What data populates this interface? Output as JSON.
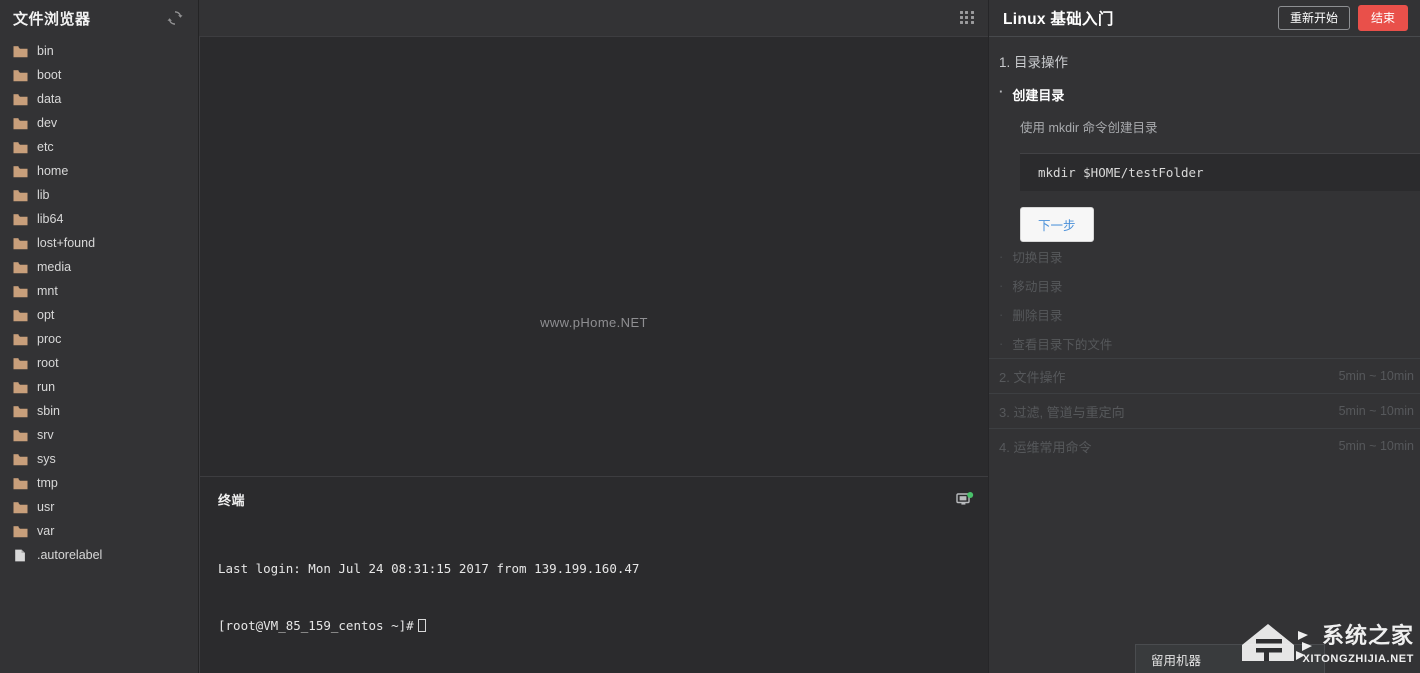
{
  "sidebar": {
    "title": "文件浏览器",
    "refresh_icon": "refresh-icon",
    "items": [
      {
        "label": "bin",
        "type": "folder"
      },
      {
        "label": "boot",
        "type": "folder"
      },
      {
        "label": "data",
        "type": "folder"
      },
      {
        "label": "dev",
        "type": "folder"
      },
      {
        "label": "etc",
        "type": "folder"
      },
      {
        "label": "home",
        "type": "folder"
      },
      {
        "label": "lib",
        "type": "folder"
      },
      {
        "label": "lib64",
        "type": "folder"
      },
      {
        "label": "lost+found",
        "type": "folder"
      },
      {
        "label": "media",
        "type": "folder"
      },
      {
        "label": "mnt",
        "type": "folder"
      },
      {
        "label": "opt",
        "type": "folder"
      },
      {
        "label": "proc",
        "type": "folder"
      },
      {
        "label": "root",
        "type": "folder"
      },
      {
        "label": "run",
        "type": "folder"
      },
      {
        "label": "sbin",
        "type": "folder"
      },
      {
        "label": "srv",
        "type": "folder"
      },
      {
        "label": "sys",
        "type": "folder"
      },
      {
        "label": "tmp",
        "type": "folder"
      },
      {
        "label": "usr",
        "type": "folder"
      },
      {
        "label": "var",
        "type": "folder"
      },
      {
        "label": ".autorelabel",
        "type": "file"
      }
    ]
  },
  "center": {
    "grid_icon": "grid-dots-icon",
    "viewer_watermark": "www.pHome.NET",
    "terminal": {
      "title": "终端",
      "status_icon": "monitor-online-icon",
      "line1": "Last login: Mon Jul 24 08:31:15 2017 from 139.199.160.47",
      "line2": "[root@VM_85_159_centos ~]#"
    }
  },
  "right": {
    "lesson_title": "Linux 基础入门",
    "restart_label": "重新开始",
    "finish_label": "结束",
    "section_title": "1. 目录操作",
    "current_task": {
      "bullet": "·",
      "name": "创建目录",
      "desc": "使用 mkdir 命令创建目录",
      "code": "mkdir $HOME/testFolder",
      "next_label": "下一步"
    },
    "pending_steps": [
      {
        "bullet": "·",
        "label": "切换目录"
      },
      {
        "bullet": "·",
        "label": "移动目录"
      },
      {
        "bullet": "·",
        "label": "删除目录"
      },
      {
        "bullet": "·",
        "label": "查看目录下的文件"
      }
    ],
    "chapters": [
      {
        "label": "2. 文件操作",
        "time": "5min ~ 10min"
      },
      {
        "label": "3. 过滤, 管道与重定向",
        "time": "5min ~ 10min"
      },
      {
        "label": "4. 运维常用命令",
        "time": "5min ~ 10min"
      }
    ],
    "retain_tab_label": "留用机器",
    "watermark": {
      "cn": "系统之家",
      "en": "XITONGZHIJIA.NET"
    }
  },
  "colors": {
    "panel_bg": "#333335",
    "dark_bg": "#2b2b2d",
    "danger": "#e9504a",
    "link": "#4a90d9",
    "folder": "#c89f7b"
  }
}
